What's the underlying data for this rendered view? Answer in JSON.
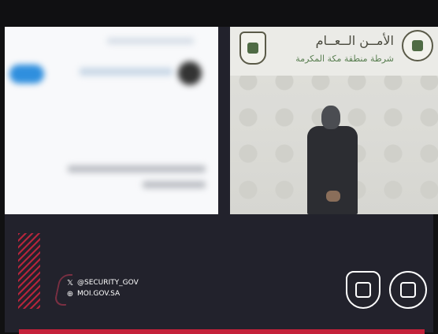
{
  "photo": {
    "header_title": "الأمــن الــعــام",
    "header_subtitle": "شرطة منطقة مكة المكرمة"
  },
  "footer": {
    "social_handle": "@SECURITY_GOV",
    "website": "MOI.GOV.SA"
  },
  "icons": {
    "x_icon": "x-logo-icon",
    "globe_icon": "globe-icon"
  },
  "colors": {
    "background": "#22222c",
    "accent_red": "#c4213a",
    "emblem_green": "#5a7f52"
  }
}
